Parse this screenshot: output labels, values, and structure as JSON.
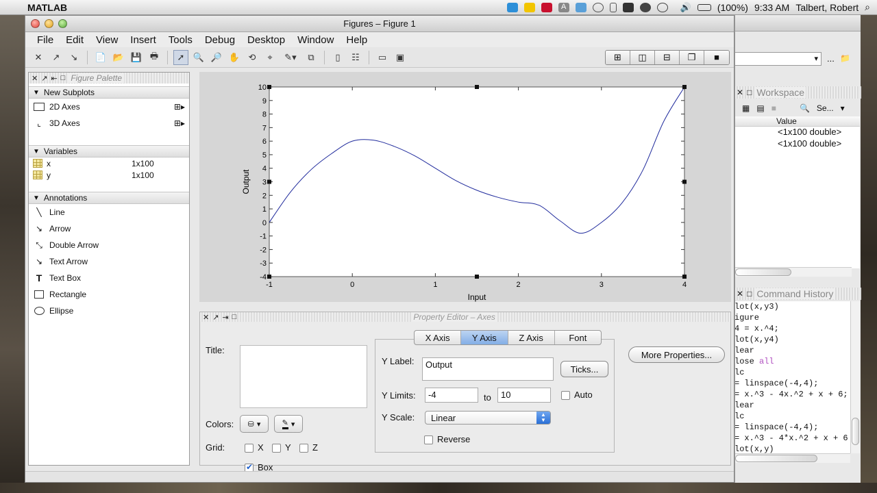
{
  "menubar": {
    "app_name": "MATLAB",
    "battery": "(100%)",
    "clock": "9:33 AM",
    "user": "Talbert, Robert"
  },
  "window": {
    "title": "Figures – Figure 1",
    "menu": [
      "File",
      "Edit",
      "View",
      "Insert",
      "Tools",
      "Debug",
      "Desktop",
      "Window",
      "Help"
    ]
  },
  "palette": {
    "title": "Figure Palette",
    "new_subplots": {
      "header": "New Subplots",
      "items": [
        "2D Axes",
        "3D Axes"
      ]
    },
    "variables": {
      "header": "Variables",
      "items": [
        {
          "name": "x",
          "size": "1x100"
        },
        {
          "name": "y",
          "size": "1x100"
        }
      ]
    },
    "annotations": {
      "header": "Annotations",
      "items": [
        "Line",
        "Arrow",
        "Double Arrow",
        "Text Arrow",
        "Text Box",
        "Rectangle",
        "Ellipse"
      ]
    }
  },
  "chart_data": {
    "type": "line",
    "x": [
      -1,
      -0.75,
      -0.5,
      -0.25,
      0,
      0.25,
      0.5,
      0.75,
      1,
      1.25,
      1.5,
      1.75,
      2,
      2.25,
      2.5,
      2.75,
      3,
      3.25,
      3.5,
      3.75,
      4
    ],
    "y": [
      0,
      2.203,
      3.875,
      5.078,
      6,
      6.078,
      5.625,
      4.922,
      4,
      3.078,
      2.375,
      1.859,
      1.5,
      1.266,
      0.125,
      -0.797,
      0,
      1.453,
      3.875,
      7.453,
      10
    ],
    "xlabel": "Input",
    "ylabel": "Output",
    "xlim": [
      -1,
      4
    ],
    "ylim": [
      -4,
      10
    ],
    "xticks": [
      -1,
      0,
      1,
      2,
      3,
      4
    ],
    "yticks": [
      -4,
      -3,
      -2,
      -1,
      0,
      1,
      2,
      3,
      4,
      5,
      6,
      7,
      8,
      9,
      10
    ],
    "grid": false,
    "box": true,
    "line_color": "#1f2a9c"
  },
  "property_editor": {
    "title": "Property Editor – Axes",
    "title_label": "Title:",
    "colors_label": "Colors:",
    "grid_label": "Grid:",
    "grid": {
      "x": "X",
      "y": "Y",
      "z": "Z",
      "box": "Box"
    },
    "tabs": [
      "X Axis",
      "Y Axis",
      "Z Axis",
      "Font"
    ],
    "active_tab": "Y Axis",
    "more_properties": "More Properties...",
    "y_label_label": "Y Label:",
    "y_label_value": "Output",
    "ticks_button": "Ticks...",
    "y_limits_label": "Y Limits:",
    "y_min": "-4",
    "to_label": "to",
    "y_max": "10",
    "auto_label": "Auto",
    "y_scale_label": "Y Scale:",
    "y_scale_value": "Linear",
    "reverse_label": "Reverse"
  },
  "right_panel": {
    "combo_more": "...",
    "workspace": {
      "title": "Workspace",
      "search": "Se...",
      "value_header": "Value",
      "values": [
        "<1x100 double>",
        "<1x100 double>"
      ]
    },
    "command_history": {
      "title": "Command History",
      "lines": [
        {
          "text": "lot(x,y3)"
        },
        {
          "text": "igure"
        },
        {
          "text": "4 = x.^4;"
        },
        {
          "text": "lot(x,y4)"
        },
        {
          "text": "lear"
        },
        {
          "pre": "lose ",
          "kw": "all"
        },
        {
          "text": "lc"
        },
        {
          "text": " = linspace(-4,4);"
        },
        {
          "text": " = x.^3 - 4x.^2 + x + 6;"
        },
        {
          "text": "lear"
        },
        {
          "text": "lc"
        },
        {
          "text": " = linspace(-4,4);"
        },
        {
          "text": " = x.^3 - 4*x.^2 + x + 6"
        },
        {
          "text": "lot(x,y)"
        }
      ]
    }
  }
}
